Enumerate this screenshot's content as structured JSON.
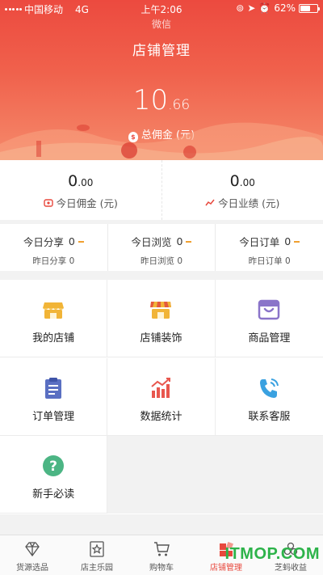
{
  "status_bar": {
    "carrier": "中国移动",
    "network": "4G",
    "time": "上午2:06",
    "battery": "62%",
    "battery_level": 0.62
  },
  "header": {
    "app_name": "微信",
    "title": "店铺管理"
  },
  "balance": {
    "int": "10",
    "dec": ".66",
    "label": "总佣金 (元)"
  },
  "stats": [
    {
      "int": "0",
      "dec": ".00",
      "label": "今日佣金 (元)",
      "icon": "coin-icon"
    },
    {
      "int": "0",
      "dec": ".00",
      "label": "今日业绩 (元)",
      "icon": "trend-icon"
    }
  ],
  "daily": [
    {
      "label": "今日分享",
      "value": "0",
      "sub": "昨日分享 0"
    },
    {
      "label": "今日浏览",
      "value": "0",
      "sub": "昨日浏览 0"
    },
    {
      "label": "今日订单",
      "value": "0",
      "sub": "昨日订单 0"
    }
  ],
  "menu": [
    {
      "label": "我的店铺",
      "icon": "store-icon",
      "color": "#f1b437"
    },
    {
      "label": "店铺装饰",
      "icon": "store-decor-icon",
      "color": "#f1b437"
    },
    {
      "label": "商品管理",
      "icon": "goods-box-icon",
      "color": "#8a74c9"
    },
    {
      "label": "订单管理",
      "icon": "clipboard-icon",
      "color": "#5a6fc2"
    },
    {
      "label": "数据统计",
      "icon": "bar-chart-icon",
      "color": "#e8574e"
    },
    {
      "label": "联系客服",
      "icon": "phone-icon",
      "color": "#3aa1e0"
    },
    {
      "label": "新手必读",
      "icon": "help-icon",
      "color": "#4cb584"
    }
  ],
  "tabs": [
    {
      "label": "货源选品",
      "icon": "diamond-icon"
    },
    {
      "label": "店主乐园",
      "icon": "star-badge-icon"
    },
    {
      "label": "购物车",
      "icon": "cart-icon"
    },
    {
      "label": "店铺管理",
      "icon": "shop-manage-icon",
      "active": true
    },
    {
      "label": "芝蚂收益",
      "icon": "sesame-icon"
    }
  ],
  "watermark": "ITMOP.COM",
  "colors": {
    "primary": "#ec4a3f",
    "accent": "#f0a030"
  }
}
